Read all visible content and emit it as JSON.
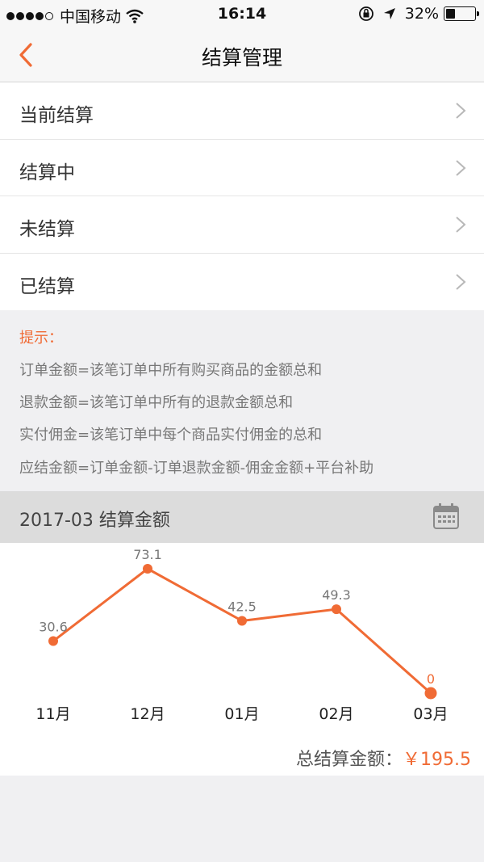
{
  "status_bar": {
    "carrier": "中国移动",
    "time": "16:14",
    "battery": "32%",
    "battery_level": 0.32,
    "signal_bars": 4
  },
  "nav": {
    "title": "结算管理"
  },
  "menu": {
    "items": [
      {
        "label": "当前结算"
      },
      {
        "label": "结算中"
      },
      {
        "label": "未结算"
      },
      {
        "label": "已结算"
      }
    ]
  },
  "tips": {
    "title": "提示：",
    "lines": [
      "订单金额=该笔订单中所有购买商品的金额总和",
      "退款金额=该笔订单中所有的退款金额总和",
      "实付佣金=该笔订单中每个商品实付佣金的总和",
      "应结金额=订单金额-订单退款金额-佣金金额+平台补助"
    ]
  },
  "chart_header": {
    "period": "2017-03  结算金额"
  },
  "chart_data": {
    "type": "line",
    "categories": [
      "11月",
      "12月",
      "01月",
      "02月",
      "03月"
    ],
    "series": [
      {
        "values": [
          30.6,
          73.1,
          42.5,
          49.3,
          0
        ],
        "labels": [
          "30.6",
          "73.1",
          "42.5",
          "49.3",
          "0"
        ]
      }
    ],
    "ylim": [
      0,
      73.1
    ],
    "highlight_index": 4,
    "color": "#f06b35"
  },
  "total": {
    "label": "总结算金额：",
    "value": "￥195.5"
  },
  "colors": {
    "accent": "#f06b35",
    "background": "#f0f0f2"
  }
}
